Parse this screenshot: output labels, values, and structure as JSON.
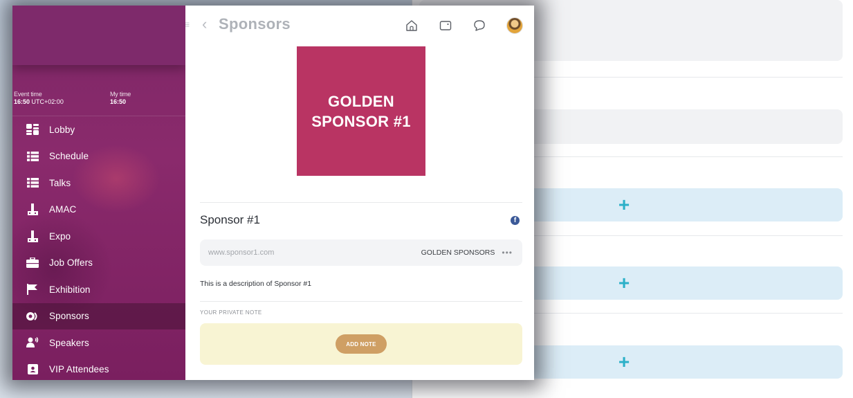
{
  "sidebar": {
    "event_time_label": "Event time",
    "event_time_value": "16:50",
    "event_tz": "UTC+02:00",
    "my_time_label": "My time",
    "my_time_value": "16:50",
    "items": [
      {
        "label": "Lobby",
        "icon": "lobby-icon"
      },
      {
        "label": "Schedule",
        "icon": "list-icon"
      },
      {
        "label": "Talks",
        "icon": "list-icon"
      },
      {
        "label": "AMAC",
        "icon": "booth-icon"
      },
      {
        "label": "Expo",
        "icon": "booth-icon"
      },
      {
        "label": "Job Offers",
        "icon": "briefcase-icon"
      },
      {
        "label": "Exhibition",
        "icon": "flag-icon"
      },
      {
        "label": "Sponsors",
        "icon": "sponsor-icon",
        "active": true
      },
      {
        "label": "Speakers",
        "icon": "speaker-icon"
      },
      {
        "label": "VIP Attendees",
        "icon": "badge-icon"
      }
    ]
  },
  "topbar": {
    "title": "Sponsors",
    "icons": [
      "home-icon",
      "wallet-icon",
      "chat-icon",
      "avatar"
    ]
  },
  "sponsor": {
    "logo_line1": "GOLDEN",
    "logo_line2": "SPONSOR #1",
    "name": "Sponsor #1",
    "url": "www.sponsor1.com",
    "category": "GOLDEN SPONSORS",
    "more": "•••",
    "description": "This is a description of Sponsor #1",
    "note_label": "YOUR PRIVATE NOTE",
    "add_note_label": "ADD NOTE"
  },
  "colors": {
    "sidebar": "#7e2a6b",
    "logo_bg": "#b93463",
    "add_note": "#cf9f64",
    "note_bg": "#f8f4d3",
    "plus": "#2bb0c8"
  }
}
